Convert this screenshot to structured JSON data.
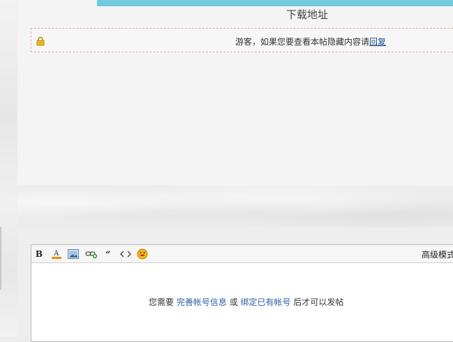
{
  "header": {
    "download_title": "下载地址"
  },
  "hidden_content": {
    "message": "游客，如果您要查看本帖隐藏内容请",
    "reply_link": "回复"
  },
  "editor": {
    "toolbar": {
      "bold_label": "B",
      "mode_label": "高级模式",
      "icons": [
        "bold-icon",
        "font-color-icon",
        "image-icon",
        "link-icon",
        "quote-icon",
        "code-icon",
        "emoji-icon"
      ]
    },
    "notice": {
      "prefix": "您需要",
      "complete_link": "完善帐号信息",
      "or": "或",
      "bind_link": "绑定已有帐号",
      "suffix": "后才可以发帖"
    }
  },
  "colors": {
    "blue_bar": "#72c8dd",
    "link": "#2a5fa6",
    "lock_border": "#f5a3a3"
  }
}
